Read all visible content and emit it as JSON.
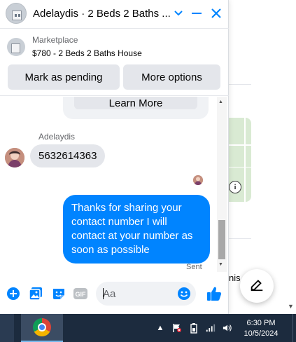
{
  "chat": {
    "title": "Adelaydis · 2 Beds 2 Baths ...",
    "listing": {
      "category": "Marketplace",
      "title": "$780 - 2 Beds 2 Baths House"
    },
    "actions": {
      "mark_pending": "Mark as pending",
      "more_options": "More options"
    },
    "learn_more": "Learn More",
    "messages": {
      "sender_name": "Adelaydis",
      "incoming_text": "5632614363",
      "outgoing_text": "Thanks for sharing your contact number I will contact at your number as soon as possible",
      "status": "Sent"
    },
    "composer": {
      "placeholder": "Aa"
    }
  },
  "background": {
    "partial_text": "nis"
  },
  "taskbar": {
    "time": "6:30 PM",
    "date": "10/5/2024"
  },
  "colors": {
    "accent": "#0084ff",
    "bubble_incoming": "#e4e6eb",
    "taskbar": "#1c2b3e"
  }
}
